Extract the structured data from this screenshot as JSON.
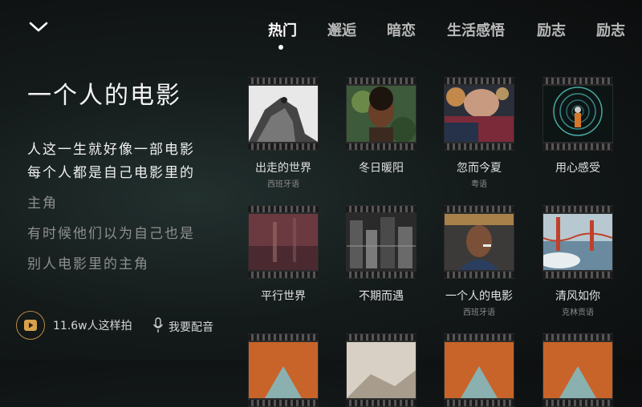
{
  "tabs": [
    {
      "label": "热门",
      "active": true
    },
    {
      "label": "邂逅",
      "active": false
    },
    {
      "label": "暗恋",
      "active": false
    },
    {
      "label": "生活感悟",
      "active": false
    },
    {
      "label": "励志",
      "active": false
    },
    {
      "label": "励志",
      "active": false
    }
  ],
  "song": {
    "title": "一个人的电影",
    "lyrics": [
      "人这一生就好像一部电影",
      "每个人都是自己电影里的",
      "主角",
      "有时候他们以为自己也是",
      "别人电影里的主角"
    ]
  },
  "footer": {
    "count_label": "11.6w人这样拍",
    "dub_label": "我要配音"
  },
  "cards": [
    {
      "name": "出走的世界",
      "sub": "西班牙语",
      "icon": "climber-thumbnail"
    },
    {
      "name": "冬日暖阳",
      "sub": "",
      "icon": "woman-leaves-thumbnail"
    },
    {
      "name": "忽而今夏",
      "sub": "粤语",
      "icon": "eyes-bokeh-thumbnail"
    },
    {
      "name": "用心感受",
      "sub": "",
      "icon": "light-tunnel-thumbnail"
    },
    {
      "name": "平行世界",
      "sub": "",
      "icon": "blurred-red-thumbnail"
    },
    {
      "name": "不期而遇",
      "sub": "",
      "icon": "bw-city-thumbnail"
    },
    {
      "name": "一个人的电影",
      "sub": "西班牙语",
      "icon": "man-smoking-thumbnail"
    },
    {
      "name": "清风如你",
      "sub": "克林贡语",
      "icon": "golden-gate-thumbnail"
    },
    {
      "name": "",
      "sub": "",
      "icon": "orange-thumbnail"
    },
    {
      "name": "",
      "sub": "",
      "icon": "beige-thumbnail"
    },
    {
      "name": "",
      "sub": "",
      "icon": "orange-thumbnail"
    },
    {
      "name": "",
      "sub": "",
      "icon": "orange-thumbnail"
    }
  ],
  "colors": {
    "accent": "#b88a4a",
    "active_tab": "#ffffff",
    "inactive_tab": "#b9b9b9"
  }
}
